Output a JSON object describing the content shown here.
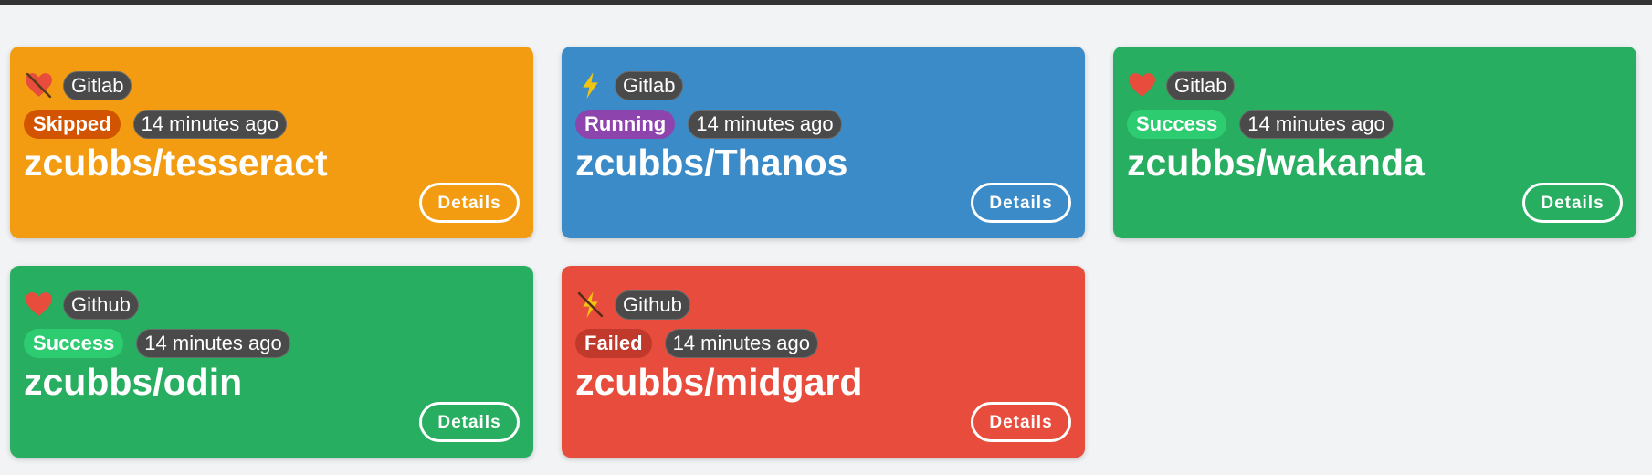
{
  "colors": {
    "orange": "#f39c12",
    "blue": "#3a8bc8",
    "green": "#27ae60",
    "red": "#e74c3c",
    "skipped_badge": "#d35400",
    "running_badge": "#8e44ad",
    "success_badge": "#2ecc71",
    "failed_badge": "#c0392b",
    "time_badge": "#4a4a4a"
  },
  "cards": [
    {
      "color": "#f39c12",
      "icon": "broken-heart-icon",
      "provider": "Gitlab",
      "status": "Skipped",
      "status_color": "#d35400",
      "time": "14 minutes ago",
      "repo": "zcubbs/tesseract",
      "details_label": "Details"
    },
    {
      "color": "#3a8bc8",
      "icon": "lightning-icon",
      "provider": "Gitlab",
      "status": "Running",
      "status_color": "#8e44ad",
      "time": "14 minutes ago",
      "repo": "zcubbs/Thanos",
      "details_label": "Details"
    },
    {
      "color": "#27ae60",
      "icon": "heart-icon",
      "provider": "Gitlab",
      "status": "Success",
      "status_color": "#2ecc71",
      "time": "14 minutes ago",
      "repo": "zcubbs/wakanda",
      "details_label": "Details"
    },
    {
      "color": "#27ae60",
      "icon": "heart-icon",
      "provider": "Github",
      "status": "Success",
      "status_color": "#2ecc71",
      "time": "14 minutes ago",
      "repo": "zcubbs/odin",
      "details_label": "Details"
    },
    {
      "color": "#e74c3c",
      "icon": "lightning-off-icon",
      "provider": "Github",
      "status": "Failed",
      "status_color": "#c0392b",
      "time": "14 minutes ago",
      "repo": "zcubbs/midgard",
      "details_label": "Details"
    }
  ]
}
